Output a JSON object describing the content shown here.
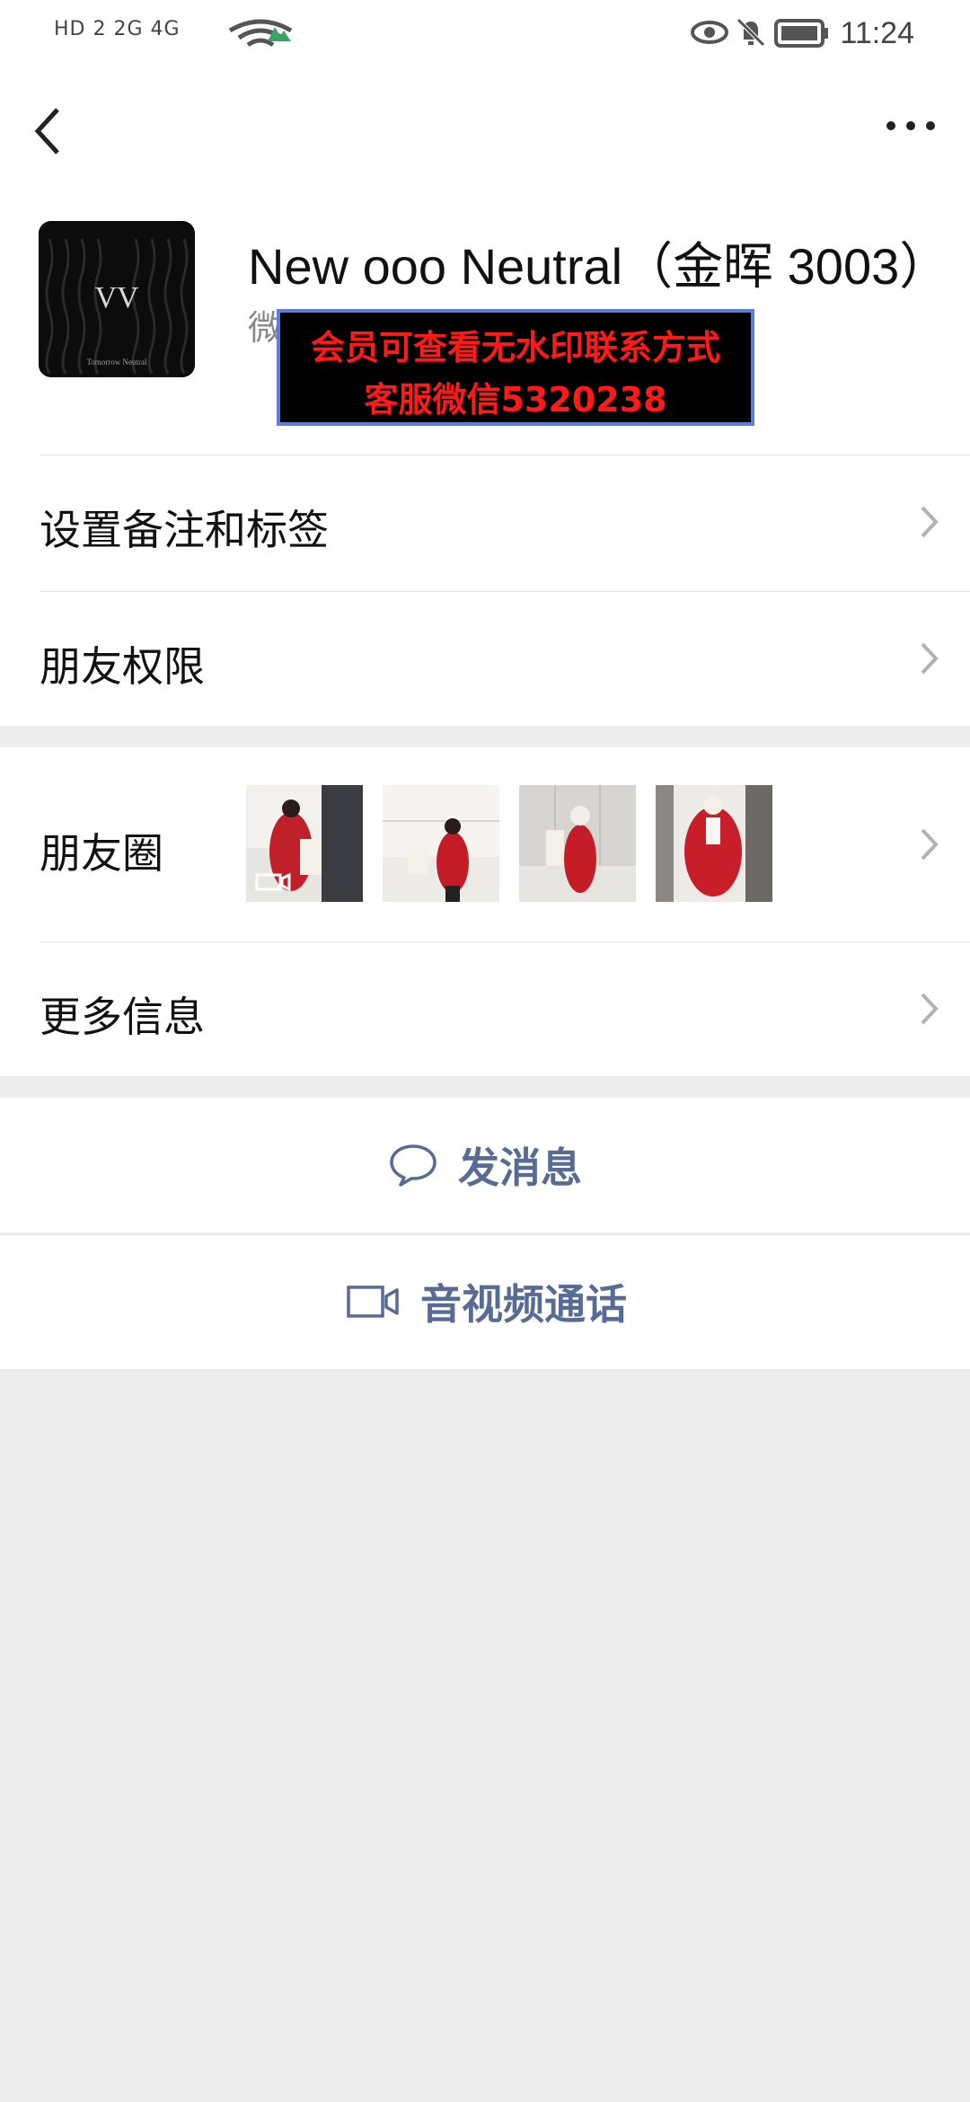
{
  "status_bar": {
    "left_text": "HD 2  2G  4G",
    "time": "11:24"
  },
  "profile": {
    "nickname": "New ooo Neutral（金晖 3003）",
    "wechat_id_prefix": "微",
    "avatar_text": "VV",
    "avatar_subtext": "Tomorrow Neutral"
  },
  "watermark": {
    "line1": "会员可查看无水印联系方式",
    "line2": "客服微信5320238"
  },
  "menu": {
    "remark_label": "设置备注和标签",
    "permission_label": "朋友权限",
    "moments_label": "朋友圈",
    "more_info_label": "更多信息"
  },
  "actions": {
    "message_label": "发消息",
    "call_label": "音视频通话"
  },
  "colors": {
    "link": "#576b95",
    "background": "#ededed",
    "watermark_text": "#ff1a1a"
  }
}
